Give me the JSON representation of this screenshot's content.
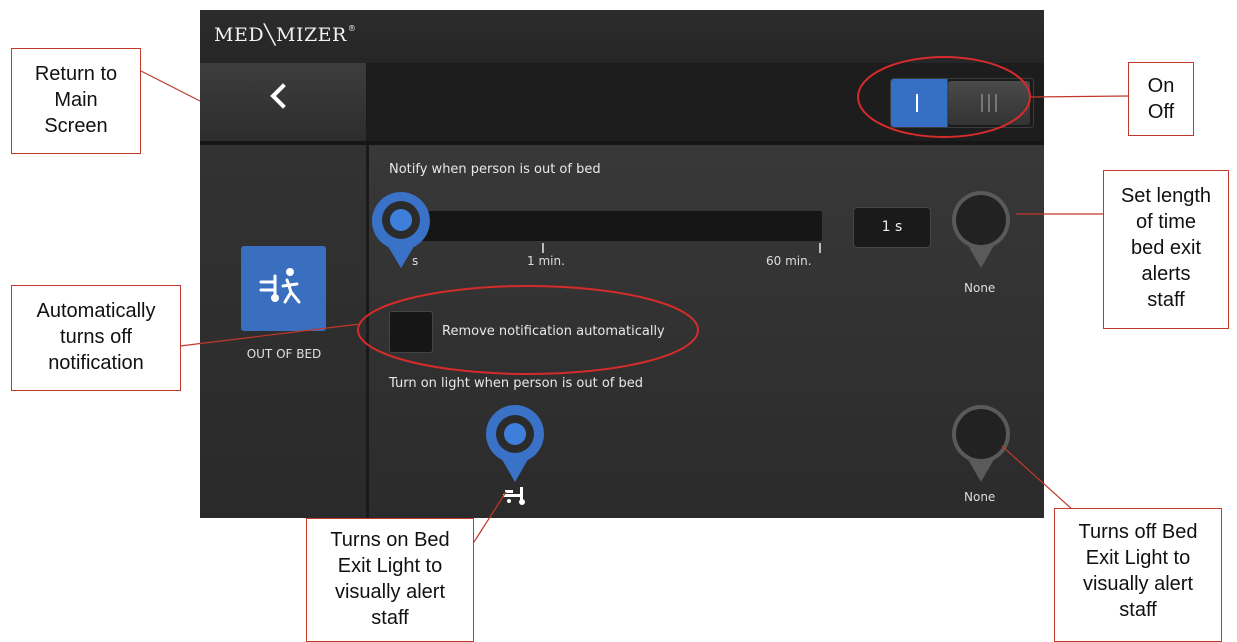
{
  "header": {
    "logo": "MED╲MIZER",
    "logo_mark": "®"
  },
  "nav": {
    "back_icon": "chevron-left-icon"
  },
  "power_toggle": {
    "on_symbol": "I",
    "state": "on",
    "on_color": "#3670c4"
  },
  "sidebar": {
    "tile_label": "OUT OF BED",
    "tile_icon": "bed-exit-person-icon",
    "tile_color": "#3a6fc0"
  },
  "notify": {
    "label": "Notify when person is out of bed",
    "ticks": [
      "s",
      "1 min.",
      "60 min."
    ],
    "value": "1 s",
    "none_label": "None"
  },
  "remove_notification": {
    "label": "Remove notification automatically",
    "checked": false
  },
  "light": {
    "label": "Turn on light when person is out of bed",
    "light_icon": "bed-light-icon",
    "none_label": "None"
  },
  "annotations": {
    "return": [
      "Return to",
      "Main",
      "Screen"
    ],
    "onoff": [
      "On",
      "Off"
    ],
    "auto_off": [
      "Automatically",
      "turns off",
      "notification"
    ],
    "length": [
      "Set length",
      "of time",
      "bed exit",
      "alerts",
      "staff"
    ],
    "turns_on": [
      "Turns on Bed",
      "Exit Light to",
      "visually alert",
      "staff"
    ],
    "turns_off": [
      "Turns off Bed",
      "Exit Light to",
      "visually alert",
      "staff"
    ],
    "accent_color": "#c0392b"
  }
}
